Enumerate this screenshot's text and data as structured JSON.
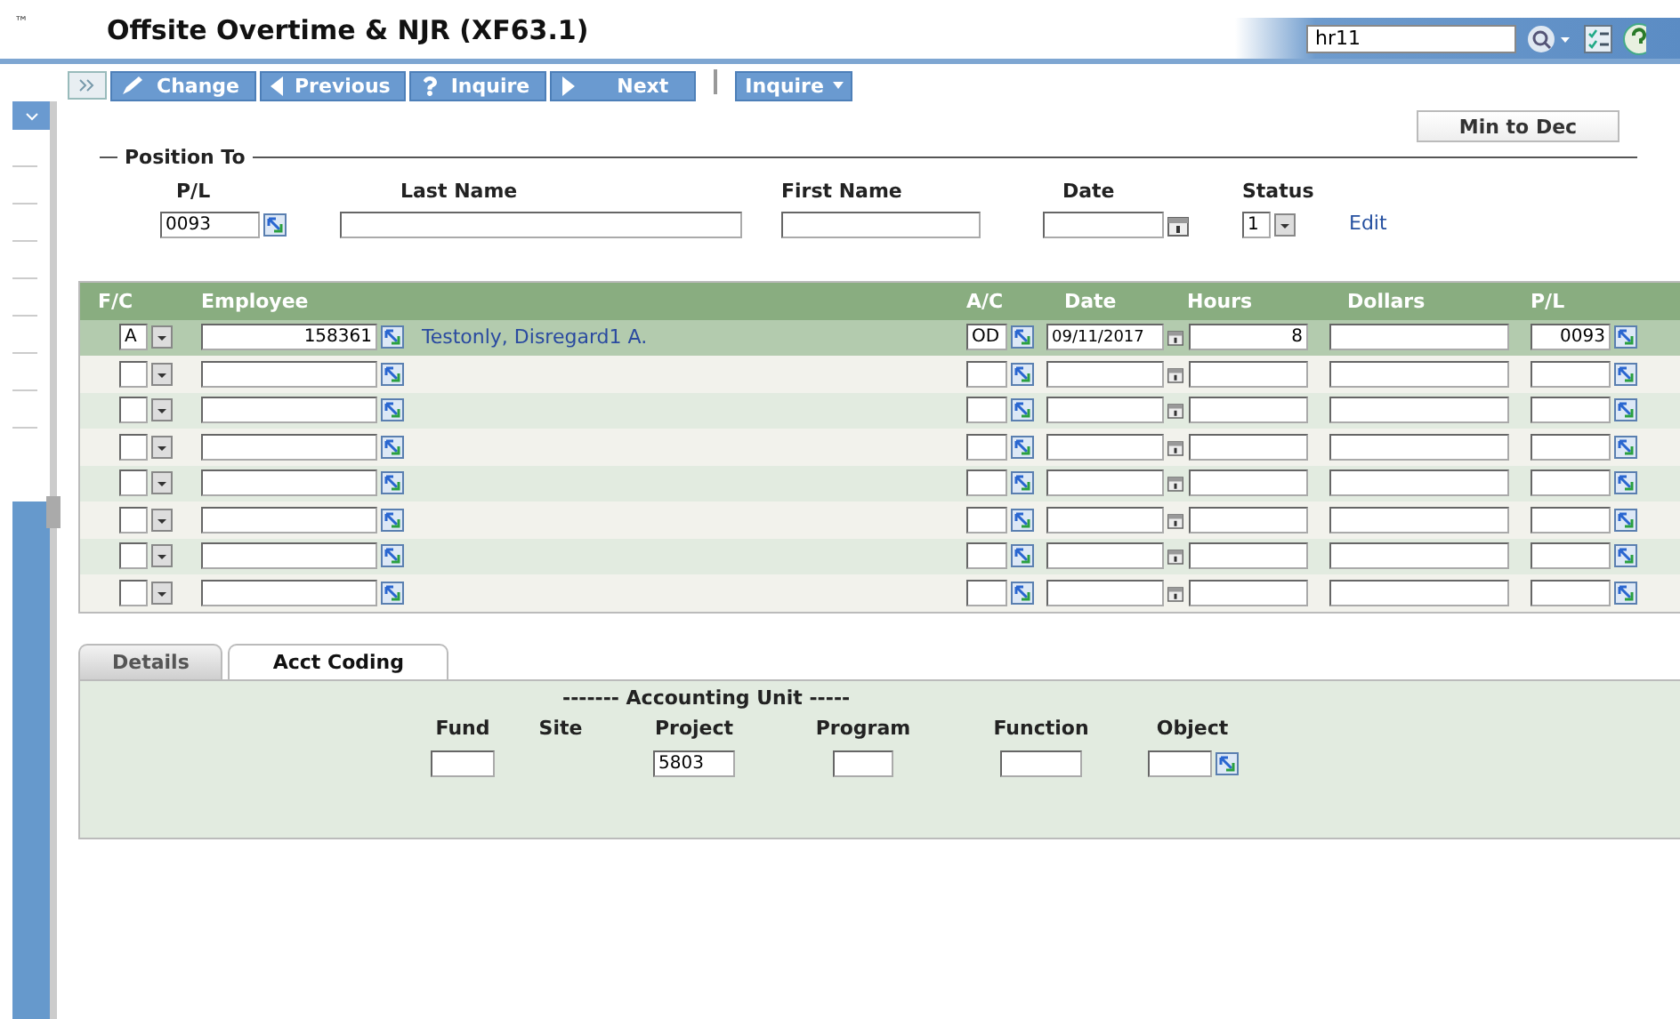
{
  "header": {
    "trademark": "™",
    "title": "Offsite Overtime & NJR (XF63.1)",
    "search_value": "hr11"
  },
  "toolbar": {
    "buttons": [
      {
        "label": "Change",
        "kind": "edit"
      },
      {
        "label": "Previous",
        "kind": "previous"
      },
      {
        "label": "Inquire",
        "kind": "inquire"
      },
      {
        "label": "Next",
        "kind": "next"
      }
    ],
    "menu": "Inquire"
  },
  "min_to_dec": "Min to Dec",
  "position_to": {
    "legend": "Position To",
    "fields": [
      {
        "label": "P/L",
        "value": "0093",
        "kind": "lookup"
      },
      {
        "label": "Last Name",
        "kind": "text"
      },
      {
        "label": "First Name",
        "kind": "text"
      },
      {
        "label": "Date",
        "kind": "date"
      },
      {
        "label": "Status",
        "value": "1",
        "kind": "select"
      }
    ],
    "edit_link": "Edit"
  },
  "grid": {
    "columns": [
      "F/C",
      "Employee",
      "A/C",
      "Date",
      "Hours",
      "Dollars",
      "P/L"
    ],
    "rows": [
      {
        "selected": true,
        "fc": "A",
        "employee": "158361",
        "name": "Testonly, Disregard1 A.",
        "ac": "OD",
        "date": "09/11/2017",
        "hours": "8",
        "pl": "0093"
      },
      {
        "selected": false
      },
      {
        "selected": false
      },
      {
        "selected": false
      },
      {
        "selected": false
      },
      {
        "selected": false
      },
      {
        "selected": false
      },
      {
        "selected": false
      }
    ]
  },
  "tabs": [
    {
      "label": "Details",
      "selected": false
    },
    {
      "label": "Acct Coding",
      "selected": true
    }
  ],
  "accounting": {
    "heading": "------- Accounting Unit -----",
    "fields": [
      {
        "label": "Fund",
        "kind": "text"
      },
      {
        "label": "Site",
        "kind": "none"
      },
      {
        "label": "Project",
        "kind": "text",
        "value": "5803"
      },
      {
        "label": "Program",
        "kind": "text"
      },
      {
        "label": "Function",
        "kind": "text"
      },
      {
        "label": "Object",
        "kind": "lookup"
      }
    ]
  }
}
